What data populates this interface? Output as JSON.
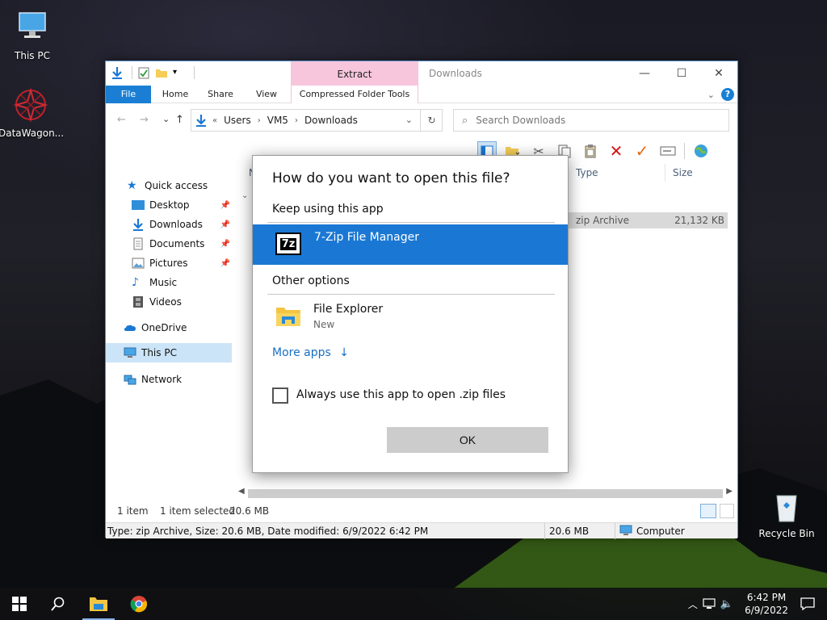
{
  "desktop": {
    "icons": [
      {
        "label": "This PC"
      },
      {
        "label": "DataWagon..."
      },
      {
        "label": "Recycle Bin"
      }
    ]
  },
  "window": {
    "title": "Downloads",
    "context_tab_group": "Extract",
    "ribbon_tabs": [
      "File",
      "Home",
      "Share",
      "View",
      "Compressed Folder Tools"
    ],
    "address": {
      "overflow": "«",
      "crumbs": [
        "Users",
        "VM5",
        "Downloads"
      ]
    },
    "search": {
      "placeholder": "Search Downloads"
    },
    "nav": {
      "quick_access": "Quick access",
      "items": [
        "Desktop",
        "Downloads",
        "Documents",
        "Pictures",
        "Music",
        "Videos"
      ],
      "onedrive": "OneDrive",
      "this_pc": "This PC",
      "network": "Network"
    },
    "columns": {
      "name": "N",
      "type": "Type",
      "size": "Size"
    },
    "file": {
      "type": "zip Archive",
      "size": "21,132 KB"
    },
    "status": {
      "items": "1 item",
      "selected": "1 item selected",
      "selected_size": "20.6 MB",
      "detail": "Type: zip Archive, Size: 20.6 MB, Date modified: 6/9/2022 6:42 PM",
      "size": "20.6 MB",
      "location": "Computer"
    }
  },
  "dialog": {
    "title": "How do you want to open this file?",
    "keep_heading": "Keep using this app",
    "current_app": "7-Zip File Manager",
    "current_app_icon_text": "7z",
    "other_heading": "Other options",
    "other_app": {
      "name": "File Explorer",
      "sub": "New"
    },
    "more_apps": "More apps",
    "always_use": "Always use this app to open .zip files",
    "always_checked": false,
    "ok": "OK"
  },
  "taskbar": {
    "time": "6:42 PM",
    "date": "6/9/2022"
  },
  "colors": {
    "accent": "#1a78d4",
    "context_tab": "#f7c6dc",
    "selection": "#cce4f7"
  }
}
